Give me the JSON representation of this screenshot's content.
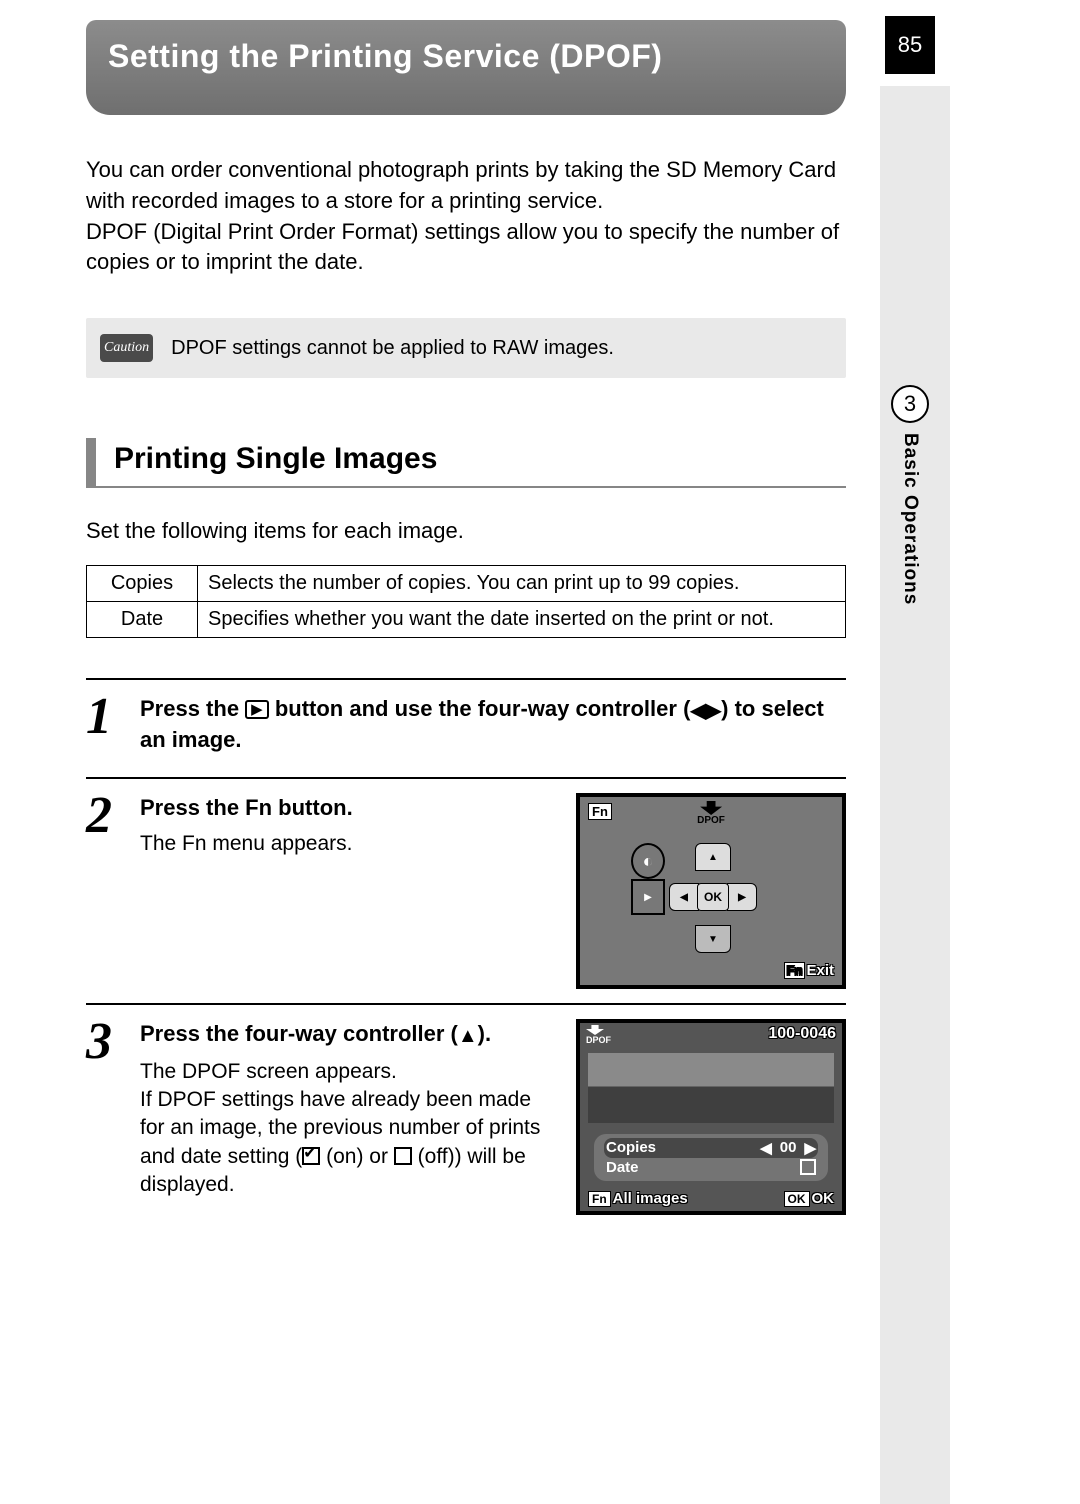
{
  "page_number": "85",
  "chapter_number": "3",
  "chapter_label": "Basic Operations",
  "title": "Setting the Printing Service (DPOF)",
  "intro": "You can order conventional photograph prints by taking the SD Memory Card with recorded images to a store for a printing service.\nDPOF (Digital Print Order Format) settings allow you to specify the number of copies or to imprint the date.",
  "caution_label": "Caution",
  "caution_text": "DPOF settings cannot be applied to RAW images.",
  "section1_heading": "Printing Single Images",
  "section1_text": "Set the following items for each image.",
  "def_rows": [
    {
      "term": "Copies",
      "desc": "Selects the number of copies. You can print up to 99 copies."
    },
    {
      "term": "Date",
      "desc": "Specifies whether you want the date inserted on the print or not."
    }
  ],
  "step1": {
    "heading_a": "Press the ",
    "heading_b": " button and use the four-way controller (",
    "heading_c": ") to select an image."
  },
  "step2": {
    "heading_a": "Press the ",
    "fn": "Fn",
    "heading_b": " button.",
    "body": "The Fn menu appears."
  },
  "step3": {
    "heading_a": "Press the four-way controller (",
    "heading_b": ").",
    "body_a": "The DPOF screen appears.",
    "body_b": "If DPOF settings have already been made for an image, the previous number of prints and date setting (",
    "body_c": " (on) or ",
    "body_d": " (off)) will be displayed."
  },
  "lcd1": {
    "fn": "Fn",
    "dpof_label": "DPOF",
    "ok": "OK",
    "exit": "Exit"
  },
  "lcd2": {
    "dpof_label": "DPOF",
    "img_number": "100-0046",
    "copies_label": "Copies",
    "copies_value": "00",
    "date_label": "Date",
    "fn_text": "All images",
    "fn": "Fn",
    "ok": "OK"
  }
}
